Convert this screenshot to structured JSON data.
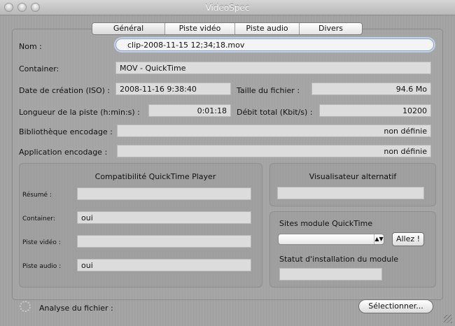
{
  "window": {
    "title": "VideoSpec"
  },
  "tabs": [
    {
      "label": "Général"
    },
    {
      "label": "Piste vidéo"
    },
    {
      "label": "Piste audio"
    },
    {
      "label": "Divers"
    }
  ],
  "general": {
    "nom_label": "Nom :",
    "nom_value": "clip-2008-11-15 12;34;18.mov",
    "container_label": "Container:",
    "container_value": "MOV - QuickTime",
    "date_label": "Date de création (ISO) :",
    "date_value": "2008-11-16 9:38:40",
    "taille_label": "Taille du fichier :",
    "taille_value": "94.6 Mo",
    "longueur_label": "Longueur de la piste (h:min:s) :",
    "longueur_value": "0:01:18",
    "debit_label": "Débit total (Kbit/s) :",
    "debit_value": "10200",
    "biblio_label": "Bibliothèque encodage :",
    "biblio_value": "non définie",
    "appli_label": "Application encodage :",
    "appli_value": "non définie"
  },
  "compat": {
    "title": "Compatibilité QuickTime Player",
    "resume_label": "Résumé :",
    "resume_value": "",
    "container_label": "Container:",
    "container_value": "oui",
    "video_label": "Piste vidéo :",
    "video_value": "",
    "audio_label": "Piste audio :",
    "audio_value": "oui"
  },
  "alt_viewer": {
    "title": "Visualisateur alternatif",
    "value": ""
  },
  "sites": {
    "title": "Sites module QuickTime",
    "select_value": "",
    "go_label": "Allez !",
    "status_title": "Statut d'installation du module",
    "status_value": ""
  },
  "footer": {
    "analyse_label": "Analyse du fichier :",
    "select_button": "Sélectionner..."
  },
  "icons": [
    "close-light",
    "minimize-light",
    "zoom-light",
    "progress-spinner-icon",
    "resize-grip-icon",
    "chevron-updown-icon"
  ]
}
